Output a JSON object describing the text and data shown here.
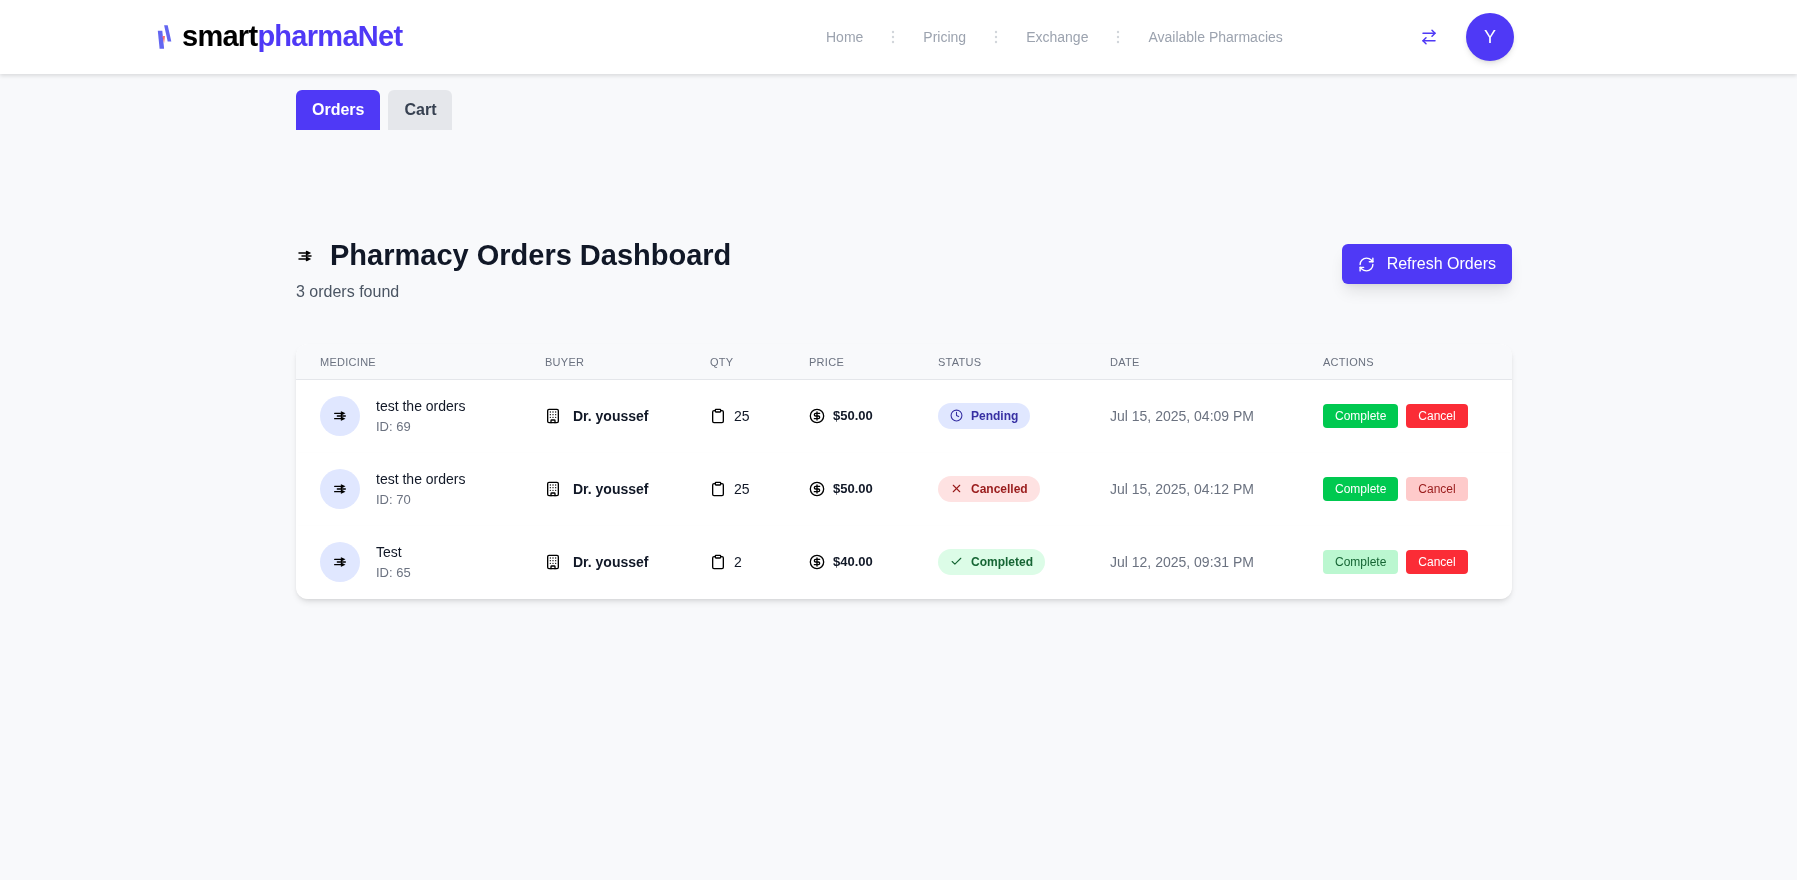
{
  "header": {
    "logo": {
      "first": "smart",
      "second": "pharmaNet"
    },
    "nav": [
      "Home",
      "Pricing",
      "Exchange",
      "Available Pharmacies"
    ],
    "avatar": "Y"
  },
  "tabs": [
    {
      "label": "Orders",
      "selected": true
    },
    {
      "label": "Cart",
      "selected": false
    }
  ],
  "dashboard": {
    "title": "Pharmacy Orders Dashboard",
    "subtitle": "3 orders found",
    "refresh_button": "Refresh Orders"
  },
  "table": {
    "columns": [
      "MEDICINE",
      "BUYER",
      "QTY",
      "PRICE",
      "STATUS",
      "DATE",
      "ACTIONS"
    ],
    "rows": [
      {
        "medicine": "test the orders",
        "id": "ID: 69",
        "buyer": "Dr. youssef",
        "qty": "25",
        "price": "$50.00",
        "status": {
          "kind": "pending",
          "label": "Pending"
        },
        "date": "Jul 15, 2025, 04:09 PM",
        "actions": [
          {
            "kind": "complete",
            "label": "Complete",
            "disabled": false
          },
          {
            "kind": "cancel",
            "label": "Cancel",
            "disabled": false
          }
        ]
      },
      {
        "medicine": "test the orders",
        "id": "ID: 70",
        "buyer": "Dr. youssef",
        "qty": "25",
        "price": "$50.00",
        "status": {
          "kind": "cancelled",
          "label": "Cancelled"
        },
        "date": "Jul 15, 2025, 04:12 PM",
        "actions": [
          {
            "kind": "complete",
            "label": "Complete",
            "disabled": false
          },
          {
            "kind": "cancel",
            "label": "Cancel",
            "disabled": true
          }
        ]
      },
      {
        "medicine": "Test",
        "id": "ID: 65",
        "buyer": "Dr. youssef",
        "qty": "2",
        "price": "$40.00",
        "status": {
          "kind": "completed",
          "label": "Completed"
        },
        "date": "Jul 12, 2025, 09:31 PM",
        "actions": [
          {
            "kind": "complete",
            "label": "Complete",
            "disabled": true
          },
          {
            "kind": "cancel",
            "label": "Cancel",
            "disabled": false
          }
        ]
      }
    ]
  }
}
